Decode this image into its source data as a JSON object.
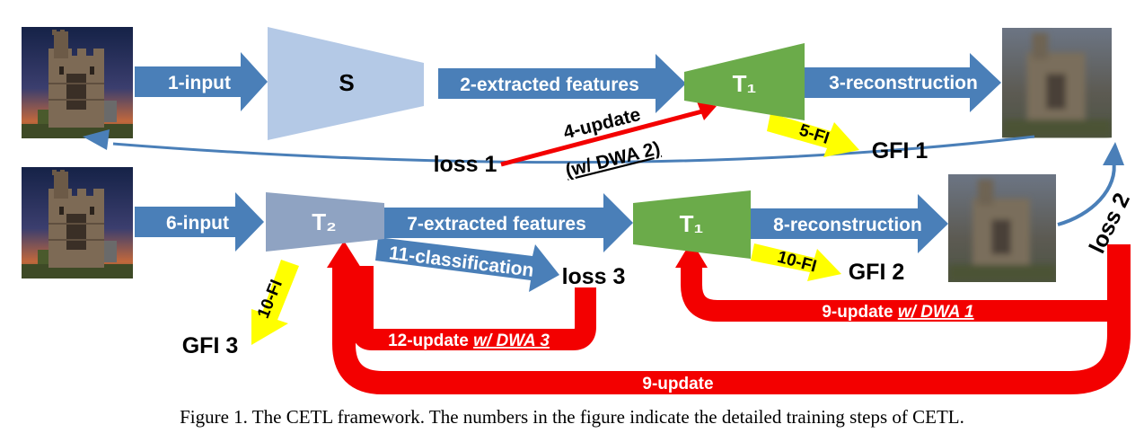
{
  "colors": {
    "blue_arrow": "#4a7fb8",
    "green_block": "#6bab4a",
    "red_arrow": "#f30000",
    "yellow_arrow": "#ffff00",
    "encoder_light": "#b4c9e6",
    "encoder_t2": "#8fa3c2"
  },
  "diagram": {
    "blocks": {
      "s": "S",
      "t1_top": "T₁",
      "t2": "T₂",
      "t1_bottom": "T₁"
    },
    "arrows": {
      "input_top": "1-input",
      "extracted_top": "2-extracted features",
      "reconstruction_top": "3-reconstruction",
      "update_4_line1": "4-update",
      "update_4_line2": "(w/ DWA 2)",
      "fi_5": "5-FI",
      "input_bottom": "6-input",
      "extracted_bottom": "7-extracted features",
      "reconstruction_bottom": "8-reconstruction",
      "update_9a_prefix": "9-update ",
      "update_9a_suffix": "w/ DWA 1",
      "fi_10_mid": "10-FI",
      "fi_10_left": "10-FI",
      "classification": "11-classification",
      "update_12_prefix": "12-update ",
      "update_12_suffix": "w/ DWA 3",
      "update_9b": "9-update"
    },
    "labels": {
      "loss1": "loss 1",
      "loss2": "loss 2",
      "loss3": "loss 3",
      "gfi1": "GFI 1",
      "gfi2": "GFI 2",
      "gfi3": "GFI 3"
    },
    "images": {
      "castle_input_top": "castle-photo",
      "castle_input_bottom": "castle-photo",
      "reconstruction_top": "blurred-castle-photo",
      "reconstruction_bottom": "blurred-castle-photo"
    }
  },
  "caption": "Figure 1. The CETL framework. The numbers in the figure indicate the detailed training steps of CETL."
}
